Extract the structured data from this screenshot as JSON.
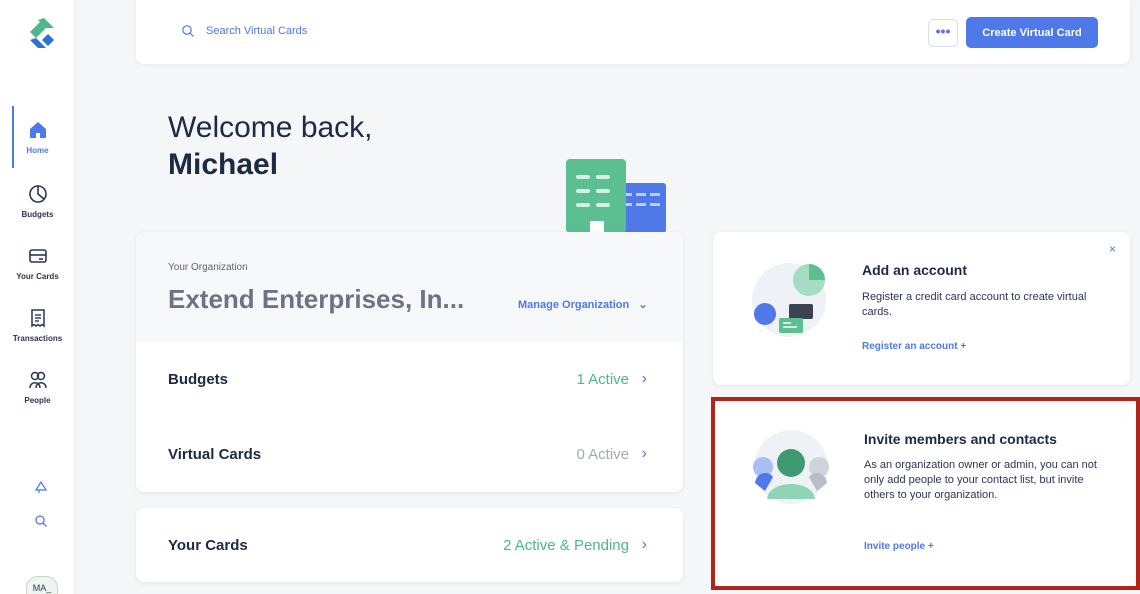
{
  "colors": {
    "accent": "#4f78e8",
    "green": "#4fb58a",
    "highlight": "#b22318"
  },
  "sidebar": {
    "items": [
      {
        "label": "Home",
        "icon": "home-icon"
      },
      {
        "label": "Budgets",
        "icon": "pie-chart-icon"
      },
      {
        "label": "Your Cards",
        "icon": "card-icon"
      },
      {
        "label": "Transactions",
        "icon": "receipt-icon"
      },
      {
        "label": "People",
        "icon": "people-icon"
      }
    ],
    "avatar": "MA_"
  },
  "topbar": {
    "search_placeholder": "Search Virtual Cards",
    "more_label": "•••",
    "create_label": "Create Virtual Card"
  },
  "welcome": {
    "line1": "Welcome back,",
    "name": "Michael"
  },
  "organization": {
    "label": "Your Organization",
    "name": "Extend Enterprises, In...",
    "manage_label": "Manage Organization",
    "rows": [
      {
        "title": "Budgets",
        "status": "1 Active"
      },
      {
        "title": "Virtual Cards",
        "status": "0 Active"
      }
    ]
  },
  "your_cards": {
    "title": "Your Cards",
    "status": "2 Active & Pending"
  },
  "add_account": {
    "title": "Add an account",
    "body": "Register a credit card account to create virtual cards.",
    "link": "Register an account +",
    "close": "×"
  },
  "invite": {
    "title": "Invite members and contacts",
    "body": "As an organization owner or admin, you can not only add people to your contact list, but invite others to your organization.",
    "link": "Invite people +"
  }
}
